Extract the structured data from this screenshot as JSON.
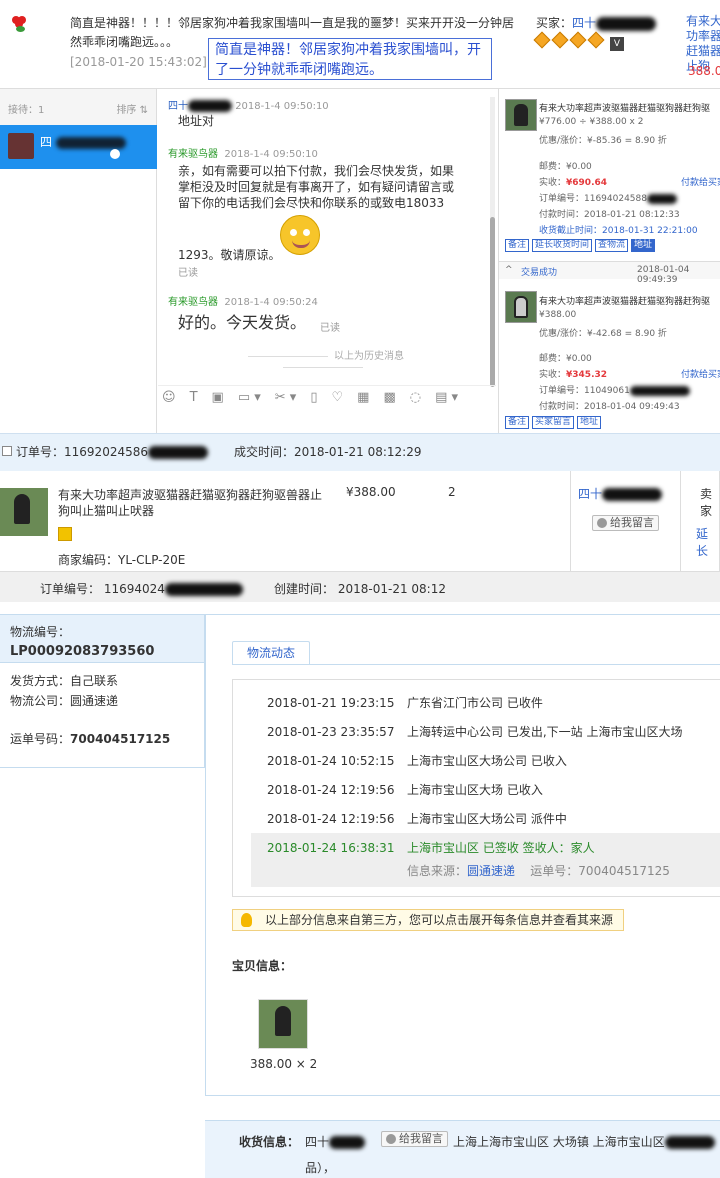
{
  "review": {
    "text": "简直是神器！！！！邻居家狗冲着我家围墙叫一直是我的噩梦！买来开开没一分钟居然乖乖闭嘴跑远。。。",
    "date": "[2018-01-20 15:43:02]",
    "overlay": "简直是神器！邻居家狗冲着我家围墙叫，开了一分钟就乖乖闭嘴跑远。",
    "buyer_label": "买家：",
    "buyer_name": "四十",
    "vip": "V",
    "right_clip": "有来大功率器赶猫器止狗",
    "right_price": "388.0"
  },
  "chat": {
    "sort_left": "接待：1",
    "sort_right": "排序 ⇅",
    "contact_name": "四",
    "msg1_name": "四十",
    "msg1_time": "2018-1-4 09:50:10",
    "msg1_body": "地址对",
    "msg2_name": "有来驱鸟器",
    "msg2_time": "2018-1-4 09:50:10",
    "msg2_body": "亲，如有需要可以拍下付款，我们会尽快发货，如果掌柜没及时回复就是有事离开了，如有疑问请留言或留下你的电话我们会尽快和你联系的或致电18033",
    "msg2_tail": "1293。敬请原谅。",
    "msg2_read": "已读",
    "msg3_name": "有来驱鸟器",
    "msg3_time": "2018-1-4 09:50:24",
    "msg3_body": "好的。今天发货。",
    "msg3_read": "已读",
    "history": "以上为历史消息",
    "toolbar": [
      "☺",
      "T",
      "▣",
      "▭ ▾",
      "✂ ▾",
      "▯",
      "♡",
      "▦",
      "▩",
      "◌",
      "▤ ▾"
    ]
  },
  "order_panel": {
    "o1_title": "有来大功率超声波驱猫器赶猫驱狗器赶狗驱",
    "o1_price_line": "¥776.00 ÷ ¥388.00 x 2",
    "o1_discount": "优惠/涨价：¥-85.36 = 8.90 折",
    "o1_postage": "邮费：¥0.00",
    "o1_paid_label": "实收：",
    "o1_paid": "¥690.64",
    "o1_pay_status": "付款给买家",
    "o1_order_no": "订单编号：11694024588",
    "o1_pay_time": "付款时间：2018-01-21 08:12:33",
    "o1_deadline": "收货截止时间：2018-01-31 22:21:00",
    "o1_buttons": [
      "备注",
      "延长收货时间",
      "查物流",
      "地址"
    ],
    "o2_status": "交易成功",
    "o2_date": "2018-01-04 09:49:39",
    "o2_title": "有来大功率超声波驱猫器赶猫驱狗器赶狗驱",
    "o2_price": "¥388.00",
    "o2_discount": "优惠/涨价：¥-42.68 = 8.90 折",
    "o2_postage": "邮费：¥0.00",
    "o2_paid_label": "实收：",
    "o2_paid": "¥345.32",
    "o2_pay_status": "付款给买家",
    "o2_order_no": "订单编号：11049061",
    "o2_pay_time": "付款时间：2018-01-04 09:49:43",
    "o2_buttons": [
      "备注",
      "买家留言",
      "地址"
    ]
  },
  "order": {
    "number_label": "订单号：",
    "number": "11692024586",
    "deal_label": "成交时间：",
    "deal_time": "2018-01-21 08:12:29",
    "product_title": "有来大功率超声波驱猫器赶猫驱狗器赶狗驱兽器止狗叫止猫叫止吠器",
    "product_price": "¥388.00",
    "product_qty": "2",
    "merchant_code": "商家编码：YL-CLP-20E",
    "seller_name": "四十",
    "leave_msg": "给我留言",
    "right_clip1": "卖家",
    "right_clip2": "延长"
  },
  "order2": {
    "number_label": "订单编号：",
    "number": "11694024",
    "created_label": "创建时间：",
    "created": "2018-01-21 08:12"
  },
  "logistics": {
    "no_label": "物流编号：",
    "no": "LP00092083793560",
    "ship_label": "发货方式：",
    "ship": "自己联系",
    "company_label": "物流公司：",
    "company": "圆通速递",
    "waybill_label": "运单号码：",
    "waybill": "700404517125",
    "tab": "物流动态",
    "tracks": [
      {
        "date": "2018-01-21 19:23:15",
        "text": "广东省江门市公司 已收件"
      },
      {
        "date": "2018-01-23 23:35:57",
        "text": "上海转运中心公司 已发出,下一站 上海市宝山区大场"
      },
      {
        "date": "2018-01-24 10:52:15",
        "text": "上海市宝山区大场公司 已收入"
      },
      {
        "date": "2018-01-24 12:19:56",
        "text": "上海市宝山区大场 已收入"
      },
      {
        "date": "2018-01-24 12:19:56",
        "text": "上海市宝山区大场公司 派件中"
      },
      {
        "date": "2018-01-24 16:38:31",
        "text": "上海市宝山区 已签收 签收人：家人"
      }
    ],
    "source_label": "信息来源：",
    "source": "圆通速递",
    "source_waybill": "运单号：700404517125",
    "notice": "以上部分信息来自第三方，您可以点击展开每条信息并查看其来源",
    "baobei_label": "宝贝信息：",
    "baobei_price": "388.00 × 2"
  },
  "receiver": {
    "label": "收货信息：",
    "name": "四十",
    "leave_msg": "给我留言",
    "address": "上海上海市宝山区 大场镇 上海市宝山区",
    "tail": "品），"
  }
}
